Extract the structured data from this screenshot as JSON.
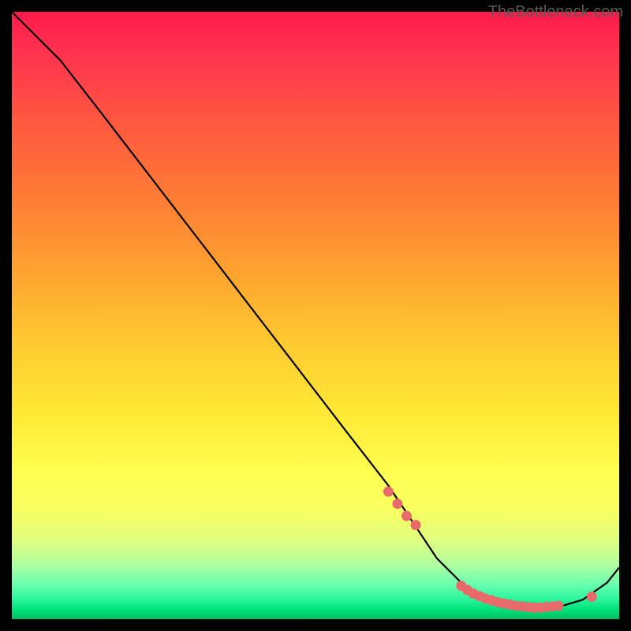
{
  "watermark": "TheBottleneck.com",
  "chart_data": {
    "type": "line",
    "title": "",
    "xlabel": "",
    "ylabel": "",
    "xlim": [
      0,
      100
    ],
    "ylim": [
      0,
      100
    ],
    "curve": {
      "x": [
        0,
        8,
        15,
        25,
        35,
        45,
        55,
        62,
        66,
        70,
        74,
        78,
        82,
        86,
        90,
        94,
        98,
        100
      ],
      "y": [
        100,
        92,
        83,
        70,
        57,
        44,
        31,
        22,
        16,
        10,
        6,
        3.5,
        2.2,
        1.8,
        2.0,
        3.2,
        6.0,
        8.5
      ]
    },
    "points_dense": {
      "x": [
        62,
        63.5,
        65,
        66.5,
        74,
        75,
        76,
        77,
        78,
        79,
        80,
        81,
        82,
        83,
        84,
        85,
        86,
        87,
        88,
        89,
        90,
        95.5
      ],
      "y": [
        21,
        19,
        17,
        15.5,
        5.5,
        4.8,
        4.2,
        3.8,
        3.4,
        3.1,
        2.8,
        2.6,
        2.4,
        2.2,
        2.1,
        2.0,
        1.9,
        1.9,
        2.0,
        2.1,
        2.2,
        3.7
      ]
    },
    "colors": {
      "curve": "#000000",
      "points": "#e86a6a"
    }
  }
}
